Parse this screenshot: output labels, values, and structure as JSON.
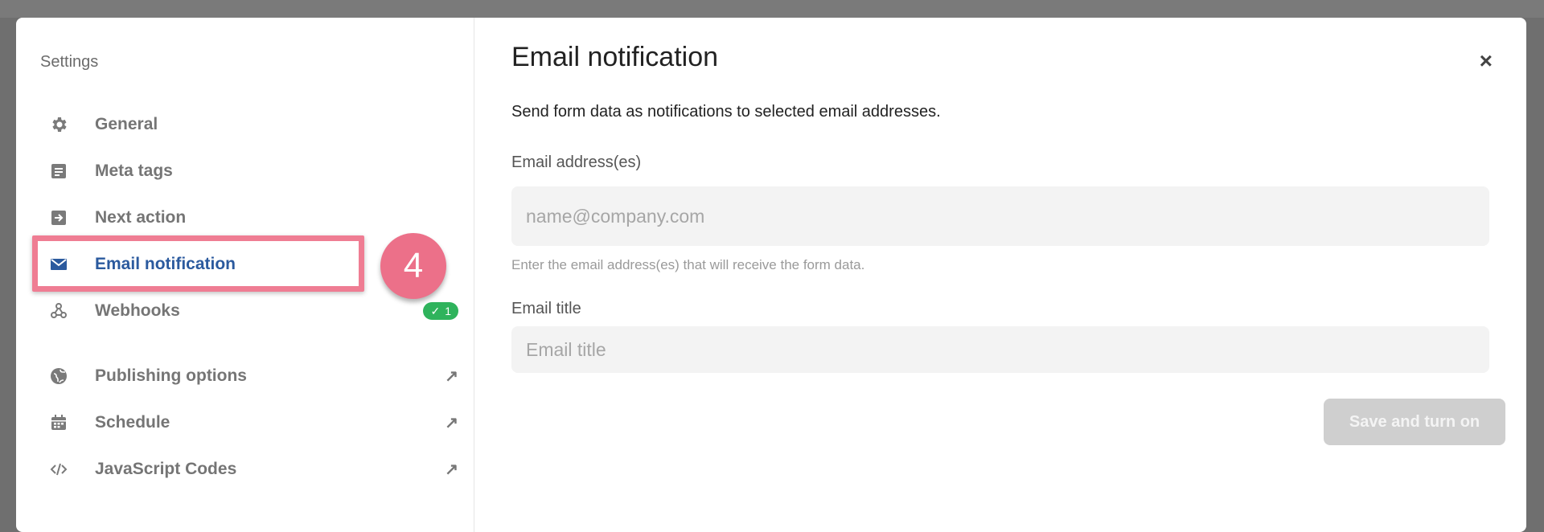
{
  "sidebar": {
    "title": "Settings",
    "items": [
      {
        "label": "General",
        "icon": "gear-icon"
      },
      {
        "label": "Meta tags",
        "icon": "document-icon"
      },
      {
        "label": "Next action",
        "icon": "arrow-box-icon"
      },
      {
        "label": "Email notification",
        "icon": "envelope-icon",
        "active": true
      },
      {
        "label": "Webhooks",
        "icon": "webhook-icon",
        "badge_count": "1"
      },
      {
        "label": "Publishing options",
        "icon": "globe-icon",
        "external": "↗"
      },
      {
        "label": "Schedule",
        "icon": "calendar-icon",
        "external": "↗"
      },
      {
        "label": "JavaScript Codes",
        "icon": "code-icon",
        "external": "↗"
      }
    ]
  },
  "annotation": {
    "step": "4"
  },
  "main": {
    "title": "Email notification",
    "close": "×",
    "description": "Send form data as notifications to selected email addresses.",
    "email_field": {
      "label": "Email address(es)",
      "placeholder": "name@company.com",
      "hint": "Enter the email address(es) that will receive the form data."
    },
    "title_field": {
      "label": "Email title",
      "placeholder": "Email title"
    },
    "save_label": "Save and turn on"
  },
  "colors": {
    "accent": "#2b5a9e",
    "badge": "#2fb35c",
    "annotation": "#ec7089",
    "button_disabled": "#cfcfcf"
  }
}
